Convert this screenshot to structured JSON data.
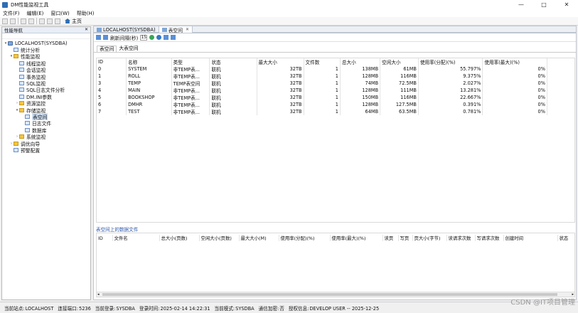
{
  "window": {
    "title": "DM性能监视工具",
    "controls": [
      "—",
      "□",
      "✕"
    ]
  },
  "menu": [
    "文件(F)",
    "编辑(E)",
    "窗口(W)",
    "帮助(H)"
  ],
  "toolbar": {
    "home_label": "主页"
  },
  "nav": {
    "header": "性能导航",
    "tree": [
      {
        "label": "LOCALHOST(SYSDBA)",
        "level": 0,
        "toggle": "▾",
        "icon": "db"
      },
      {
        "label": "统计分析",
        "level": 1,
        "toggle": "",
        "icon": "page"
      },
      {
        "label": "性能监视",
        "level": 1,
        "toggle": "▾",
        "icon": "folder"
      },
      {
        "label": "线程监视",
        "level": 2,
        "toggle": "",
        "icon": "page"
      },
      {
        "label": "会话监视",
        "level": 2,
        "toggle": "",
        "icon": "page"
      },
      {
        "label": "事务监视",
        "level": 2,
        "toggle": "",
        "icon": "page"
      },
      {
        "label": "SQL监视",
        "level": 2,
        "toggle": "",
        "icon": "page"
      },
      {
        "label": "SQL日志文件分析",
        "level": 2,
        "toggle": "",
        "icon": "page"
      },
      {
        "label": "DM.INI参数",
        "level": 2,
        "toggle": "",
        "icon": "page"
      },
      {
        "label": "资源监控",
        "level": 2,
        "toggle": "›",
        "icon": "folder"
      },
      {
        "label": "存储监视",
        "level": 2,
        "toggle": "▾",
        "icon": "folder"
      },
      {
        "label": "表空间",
        "level": 3,
        "toggle": "",
        "icon": "page",
        "selected": true
      },
      {
        "label": "日志文件",
        "level": 3,
        "toggle": "",
        "icon": "page"
      },
      {
        "label": "数据库",
        "level": 3,
        "toggle": "",
        "icon": "page"
      },
      {
        "label": "系统监视",
        "level": 2,
        "toggle": "›",
        "icon": "folder"
      },
      {
        "label": "调优向导",
        "level": 1,
        "toggle": "›",
        "icon": "folder"
      },
      {
        "label": "预警配置",
        "level": 1,
        "toggle": "",
        "icon": "page"
      }
    ]
  },
  "tabs": [
    {
      "label": "LOCALHOST(SYSDBA)"
    },
    {
      "label": "表空间",
      "close": "✕"
    }
  ],
  "main": {
    "refresh_label": "刷新间隔(秒)",
    "refresh_value": "15",
    "subtabs": [
      "表空间",
      "大表空间"
    ],
    "columns": [
      "ID",
      "名称",
      "类型",
      "状态",
      "最大大小",
      "文件数",
      "总大小",
      "空闲大小",
      "使用率(分配)(%)",
      "使用率(最大)(%)"
    ],
    "rows": [
      [
        "0",
        "SYSTEM",
        "非TEMP表...",
        "联机",
        "32TB",
        "1",
        "138MB",
        "61MB",
        "55.797%",
        "0%"
      ],
      [
        "1",
        "ROLL",
        "非TEMP表...",
        "联机",
        "32TB",
        "1",
        "128MB",
        "116MB",
        "9.375%",
        "0%"
      ],
      [
        "3",
        "TEMP",
        "TEMP表空间",
        "联机",
        "32TB",
        "1",
        "74MB",
        "72.5MB",
        "2.027%",
        "0%"
      ],
      [
        "4",
        "MAIN",
        "非TEMP表...",
        "联机",
        "32TB",
        "1",
        "128MB",
        "111MB",
        "13.281%",
        "0%"
      ],
      [
        "5",
        "BOOKSHOP",
        "非TEMP表...",
        "联机",
        "32TB",
        "1",
        "150MB",
        "116MB",
        "22.667%",
        "0%"
      ],
      [
        "6",
        "DMHR",
        "非TEMP表...",
        "联机",
        "32TB",
        "1",
        "128MB",
        "127.5MB",
        "0.391%",
        "0%"
      ],
      [
        "7",
        "TEST",
        "非TEMP表...",
        "联机",
        "32TB",
        "1",
        "64MB",
        "63.5MB",
        "0.781%",
        "0%"
      ]
    ],
    "datafile_title": "表空间上的数据文件",
    "datafile_columns": [
      "ID",
      "文件名",
      "总大小(页数)",
      "空闲大小(页数)",
      "最大大小(M)",
      "使用率(分配)(%)",
      "使用率(最大)(%)",
      "读页",
      "写页",
      "页大小(字节)",
      "读请求次数",
      "写请求次数",
      "创建时间",
      "状态"
    ]
  },
  "status": [
    {
      "label": "当前站点:",
      "value": "LOCALHOST"
    },
    {
      "label": "连接端口:",
      "value": "5236"
    },
    {
      "label": "当前登录:",
      "value": "SYSDBA"
    },
    {
      "label": "登录时间:",
      "value": "2025-02-14 14:22:31"
    },
    {
      "label": "当前模式:",
      "value": "SYSDBA"
    },
    {
      "label": "通信加密:",
      "value": "否"
    },
    {
      "label": "授权信息:",
      "value": "DEVELOP USER -- 2025-12-25"
    }
  ],
  "watermark": "CSDN @IT项目管理"
}
